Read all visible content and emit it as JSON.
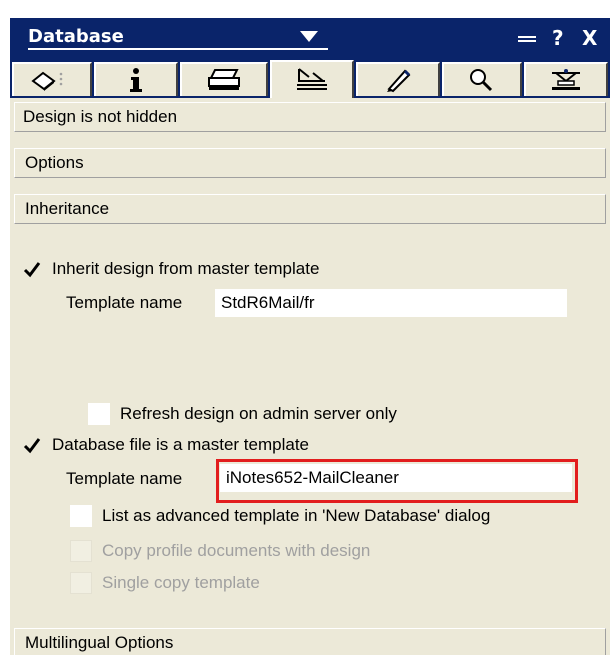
{
  "titlebar": {
    "title": "Database",
    "dock_icon": "dock-icon",
    "help_label": "?",
    "close_label": "X"
  },
  "tabs": [
    {
      "icon": "info-tab-icon"
    },
    {
      "icon": "i-info-icon"
    },
    {
      "icon": "printer-icon"
    },
    {
      "icon": "design-icon"
    },
    {
      "icon": "pen-icon"
    },
    {
      "icon": "search-icon"
    },
    {
      "icon": "advanced-icon"
    }
  ],
  "sections": {
    "design_hidden": "Design is not hidden",
    "options": "Options",
    "inheritance": "Inheritance",
    "multilingual": "Multilingual Options"
  },
  "inheritance": {
    "inherit_label": "Inherit design from master template",
    "inherit_checked": true,
    "template_name_label": "Template name",
    "template_name_value": "StdR6Mail/fr",
    "refresh_label": "Refresh design on admin server only",
    "refresh_checked": false,
    "master_label": "Database file is a master template",
    "master_checked": true,
    "master_name_label": "Template name",
    "master_name_value": "iNotes652-MailCleaner",
    "advanced_label": "List as advanced template in 'New Database' dialog",
    "advanced_checked": false,
    "copy_profile_label": "Copy profile documents with design",
    "single_copy_label": "Single copy template"
  },
  "colors": {
    "titlebar": "#0a246a",
    "panel": "#ece9d8",
    "highlight": "#e21d1d"
  }
}
